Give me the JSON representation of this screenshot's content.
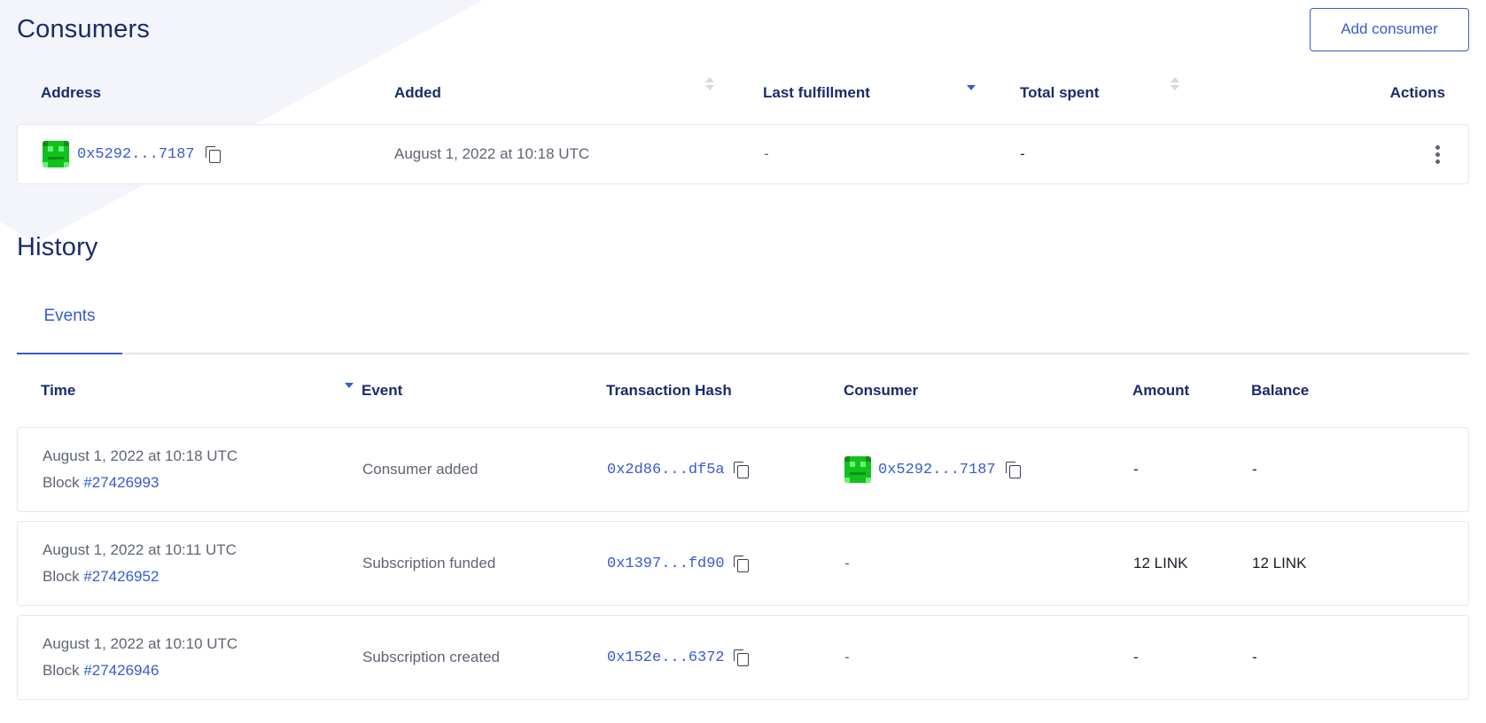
{
  "consumers": {
    "title": "Consumers",
    "add_button": "Add consumer",
    "columns": {
      "address": "Address",
      "added": "Added",
      "last_fulfillment": "Last fulfillment",
      "total_spent": "Total spent",
      "actions": "Actions"
    },
    "rows": [
      {
        "address": "0x5292...7187",
        "added": "August 1, 2022 at 10:18 UTC",
        "last_fulfillment": "-",
        "total_spent": "-"
      }
    ]
  },
  "history": {
    "title": "History",
    "tabs": [
      {
        "label": "Events",
        "active": true
      }
    ],
    "columns": {
      "time": "Time",
      "event": "Event",
      "tx_hash": "Transaction Hash",
      "consumer": "Consumer",
      "amount": "Amount",
      "balance": "Balance"
    },
    "block_prefix": "Block",
    "rows": [
      {
        "time": "August 1, 2022 at 10:18 UTC",
        "block": "#27426993",
        "event": "Consumer added",
        "tx_hash": "0x2d86...df5a",
        "consumer": "0x5292...7187",
        "amount": "-",
        "balance": "-"
      },
      {
        "time": "August 1, 2022 at 10:11 UTC",
        "block": "#27426952",
        "event": "Subscription funded",
        "tx_hash": "0x1397...fd90",
        "consumer": "-",
        "amount": "12 LINK",
        "balance": "12 LINK"
      },
      {
        "time": "August 1, 2022 at 10:10 UTC",
        "block": "#27426946",
        "event": "Subscription created",
        "tx_hash": "0x152e...6372",
        "consumer": "-",
        "amount": "-",
        "balance": "-"
      }
    ]
  },
  "colors": {
    "accent": "#375bd2",
    "heading": "#1a2b6b",
    "muted": "#5e6475",
    "avatar": "#11c21e"
  },
  "icons": {
    "copy": "copy-icon",
    "sort": "sort-icon",
    "actions": "kebab-menu-icon",
    "avatar": "blockie-avatar"
  }
}
